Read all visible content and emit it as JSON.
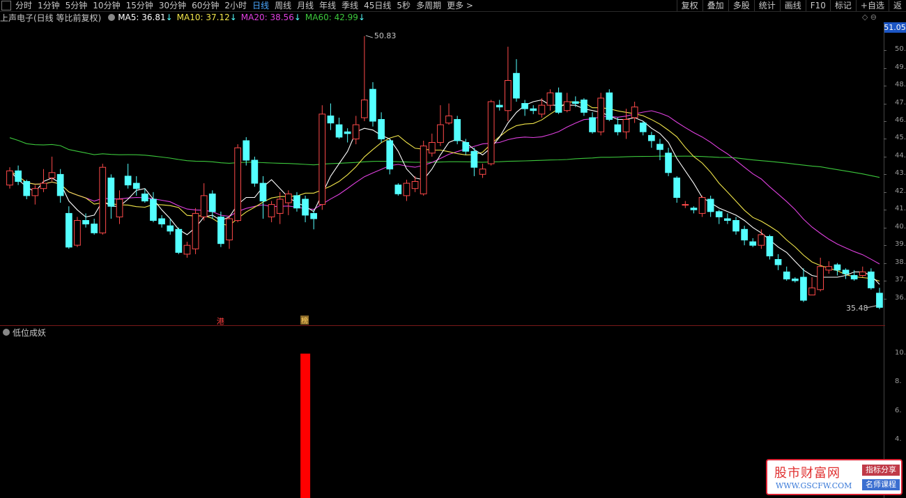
{
  "menu": {
    "periods": [
      "分时",
      "1分钟",
      "5分钟",
      "10分钟",
      "15分钟",
      "30分钟",
      "60分钟",
      "2小时",
      "日线",
      "周线",
      "月线",
      "年线",
      "季线",
      "45日线",
      "5秒",
      "多周期",
      "更多 >"
    ],
    "active_index": 8,
    "tools": [
      "复权",
      "叠加",
      "多股",
      "统计",
      "画线",
      "F10",
      "标记",
      "+自选",
      "返"
    ]
  },
  "indicators": {
    "title": "上声电子(日线 等比前复权)",
    "ma5": "MA5: 36.81",
    "ma10": "MA10: 37.12",
    "ma20": "MA20: 38.56",
    "ma60": "MA60: 42.99",
    "ma5_color": "#ffffff",
    "ma10_color": "#f2e64a",
    "ma20_color": "#e040e0",
    "ma60_color": "#3cc83c",
    "down_arrow": "↓"
  },
  "price_axis": {
    "current_price": "51.05",
    "labels": [
      "50.",
      "49.",
      "48.",
      "47.",
      "46.",
      "45.",
      "44.",
      "43.",
      "42.",
      "41.",
      "40.",
      "39.",
      "38.",
      "37.",
      "36."
    ],
    "high_label": "50.83",
    "low_label": "35.48"
  },
  "markers": {
    "gang": "港",
    "bang": "榜"
  },
  "sub_panel": {
    "title": "低位成妖",
    "axis_labels": [
      "10.",
      "8.",
      "6.",
      "4."
    ],
    "signal_value": 10,
    "signal_color": "#ff0000"
  },
  "colors": {
    "up": "#ff4a4a",
    "down": "#54ffff",
    "background": "#000000"
  },
  "watermark": {
    "name": "股市财富网",
    "url": "WWW.GSCFW.COM",
    "badge1": "指标分享",
    "badge2": "名师课程"
  },
  "chart_data": {
    "type": "candlestick",
    "ylim": [
      35,
      51.5
    ],
    "candles": [
      [
        42.4,
        43.2,
        43.4,
        42.2
      ],
      [
        43.2,
        42.6,
        43.5,
        42.4
      ],
      [
        42.6,
        41.8,
        42.7,
        41.6
      ],
      [
        41.8,
        42.2,
        42.4,
        41.3
      ],
      [
        42.2,
        42.5,
        43.3,
        42.0
      ],
      [
        42.8,
        43.1,
        44.0,
        42.6
      ],
      [
        43.0,
        41.8,
        43.3,
        41.4
      ],
      [
        40.8,
        38.9,
        41.2,
        38.8
      ],
      [
        39.0,
        40.4,
        40.6,
        38.9
      ],
      [
        40.4,
        40.2,
        40.8,
        40.0
      ],
      [
        40.2,
        39.7,
        40.5,
        39.6
      ],
      [
        39.7,
        43.4,
        43.6,
        39.6
      ],
      [
        42.8,
        41.2,
        43.0,
        40.5
      ],
      [
        40.6,
        41.6,
        42.1,
        40.2
      ],
      [
        42.9,
        42.4,
        43.6,
        42.2
      ],
      [
        42.5,
        42.2,
        42.9,
        41.8
      ],
      [
        41.9,
        41.5,
        42.2,
        41.4
      ],
      [
        41.6,
        40.4,
        42.0,
        40.3
      ],
      [
        40.5,
        40.2,
        40.7,
        40.0
      ],
      [
        40.1,
        39.8,
        40.5,
        39.6
      ],
      [
        39.9,
        38.6,
        40.0,
        38.5
      ],
      [
        38.5,
        39.0,
        39.2,
        38.3
      ],
      [
        38.8,
        40.8,
        41.1,
        38.5
      ],
      [
        40.6,
        41.8,
        42.5,
        40.4
      ],
      [
        41.9,
        40.9,
        42.1,
        40.5
      ],
      [
        40.6,
        39.1,
        40.9,
        38.9
      ],
      [
        39.3,
        40.5,
        40.7,
        38.8
      ],
      [
        40.4,
        44.5,
        44.7,
        40.3
      ],
      [
        44.9,
        43.8,
        45.1,
        43.5
      ],
      [
        43.8,
        42.5,
        44.0,
        42.3
      ],
      [
        42.5,
        41.5,
        42.9,
        40.5
      ],
      [
        40.6,
        41.3,
        41.5,
        40.3
      ],
      [
        40.8,
        41.6,
        42.0,
        40.2
      ],
      [
        41.4,
        41.9,
        42.1,
        40.7
      ],
      [
        41.8,
        41.1,
        42.0,
        40.9
      ],
      [
        41.6,
        40.7,
        41.8,
        40.3
      ],
      [
        40.8,
        40.5,
        41.0,
        39.9
      ],
      [
        41.3,
        46.4,
        46.9,
        41.0
      ],
      [
        46.3,
        45.9,
        47.0,
        45.5
      ],
      [
        45.8,
        45.1,
        46.2,
        45.0
      ],
      [
        45.4,
        45.3,
        45.6,
        44.8
      ],
      [
        45.0,
        45.8,
        46.3,
        44.7
      ],
      [
        46.2,
        47.2,
        50.8,
        46.0
      ],
      [
        47.8,
        46.0,
        48.2,
        45.7
      ],
      [
        46.1,
        45.0,
        46.5,
        44.8
      ],
      [
        44.9,
        43.3,
        45.0,
        43.0
      ],
      [
        42.4,
        41.9,
        42.5,
        41.8
      ],
      [
        41.8,
        42.5,
        42.7,
        41.5
      ],
      [
        42.2,
        42.6,
        42.9,
        42.0
      ],
      [
        41.9,
        44.6,
        44.9,
        41.8
      ],
      [
        44.2,
        44.8,
        45.3,
        44.0
      ],
      [
        44.8,
        45.8,
        46.9,
        44.6
      ],
      [
        45.9,
        46.3,
        47.0,
        45.8
      ],
      [
        46.1,
        44.9,
        46.3,
        44.7
      ],
      [
        44.8,
        44.3,
        45.0,
        44.1
      ],
      [
        44.3,
        43.4,
        44.5,
        42.9
      ],
      [
        43.0,
        43.3,
        43.6,
        42.8
      ],
      [
        43.6,
        47.1,
        47.2,
        43.5
      ],
      [
        46.9,
        46.8,
        47.2,
        46.6
      ],
      [
        46.6,
        48.3,
        50.2,
        46.0
      ],
      [
        48.7,
        47.3,
        49.5,
        47.1
      ],
      [
        47.0,
        46.7,
        47.2,
        46.3
      ],
      [
        46.7,
        46.6,
        46.9,
        46.4
      ],
      [
        46.4,
        46.9,
        47.3,
        46.2
      ],
      [
        46.9,
        47.6,
        47.8,
        46.6
      ],
      [
        47.6,
        46.5,
        47.9,
        46.4
      ],
      [
        46.6,
        47.1,
        47.6,
        46.5
      ],
      [
        47.1,
        47.0,
        47.4,
        46.8
      ],
      [
        47.2,
        46.5,
        47.3,
        46.3
      ],
      [
        46.2,
        45.4,
        46.5,
        45.3
      ],
      [
        45.4,
        47.3,
        47.6,
        45.2
      ],
      [
        47.6,
        46.1,
        47.8,
        46.0
      ],
      [
        45.8,
        45.4,
        46.2,
        45.2
      ],
      [
        45.4,
        46.1,
        46.7,
        45.0
      ],
      [
        46.2,
        46.8,
        47.1,
        45.9
      ],
      [
        45.9,
        45.4,
        46.0,
        45.2
      ],
      [
        45.2,
        44.9,
        45.4,
        44.5
      ],
      [
        44.7,
        44.4,
        45.0,
        43.8
      ],
      [
        44.2,
        43.1,
        44.5,
        42.9
      ],
      [
        42.8,
        41.7,
        42.9,
        41.4
      ],
      [
        41.3,
        41.3,
        41.5,
        41.1
      ],
      [
        41.1,
        41.0,
        41.2,
        40.8
      ],
      [
        40.8,
        41.7,
        41.8,
        40.6
      ],
      [
        41.6,
        40.9,
        41.8,
        40.6
      ],
      [
        40.9,
        40.6,
        41.0,
        40.2
      ],
      [
        40.5,
        40.4,
        40.8,
        40.2
      ],
      [
        40.4,
        39.8,
        40.6,
        39.6
      ],
      [
        39.9,
        39.3,
        40.1,
        39.0
      ],
      [
        39.2,
        39.0,
        39.4,
        38.9
      ],
      [
        39.0,
        39.6,
        39.9,
        38.8
      ],
      [
        39.5,
        38.4,
        39.6,
        38.2
      ],
      [
        38.2,
        37.9,
        38.5,
        37.6
      ],
      [
        37.5,
        37.1,
        37.8,
        37.0
      ],
      [
        37.1,
        37.0,
        37.2,
        36.9
      ],
      [
        37.2,
        35.9,
        37.7,
        35.8
      ],
      [
        36.2,
        36.6,
        37.2,
        36.2
      ],
      [
        36.5,
        37.8,
        38.3,
        36.4
      ],
      [
        37.6,
        37.8,
        38.1,
        37.4
      ],
      [
        37.9,
        37.6,
        38.0,
        37.3
      ],
      [
        37.6,
        37.4,
        37.7,
        37.1
      ],
      [
        37.3,
        37.1,
        37.6,
        37.0
      ],
      [
        37.3,
        37.5,
        37.8,
        37.2
      ],
      [
        37.5,
        36.6,
        37.7,
        36.5
      ],
      [
        36.3,
        35.5,
        36.6,
        35.4
      ]
    ],
    "ma5": [
      43.2,
      42.7,
      42.3,
      42.0,
      42.6,
      42.8,
      42.5,
      41.5,
      41.0,
      40.6,
      40.7,
      41.5,
      41.2,
      41.2,
      41.6,
      42.1,
      42.2,
      41.6,
      41.0,
      40.5,
      39.9,
      39.6,
      40.0,
      40.6,
      40.7,
      40.4,
      40.6,
      41.3,
      41.7,
      41.7,
      42.3,
      42.7,
      42.2,
      41.7,
      41.4,
      41.2,
      40.9,
      41.9,
      42.9,
      43.6,
      44.3,
      45.4,
      45.6,
      45.5,
      45.2,
      45.0,
      44.3,
      43.3,
      42.8,
      42.7,
      43.3,
      44.1,
      44.8,
      45.0,
      44.8,
      44.4,
      44.1,
      44.5,
      45.1,
      45.9,
      46.5,
      46.9,
      47.1,
      47.2,
      46.9,
      46.9,
      46.9,
      46.9,
      46.7,
      46.6,
      46.5,
      46.3,
      46.1,
      46.1,
      46.2,
      46.0,
      45.6,
      45.3,
      44.8,
      43.9,
      43.2,
      42.5,
      41.7,
      41.4,
      41.1,
      40.9,
      40.7,
      40.4,
      40.0,
      39.7,
      39.3,
      38.9,
      38.6,
      38.1,
      37.6,
      37.3,
      37.2,
      37.2,
      37.2,
      37.3,
      37.5,
      37.5,
      37.3,
      36.8
    ]
  }
}
